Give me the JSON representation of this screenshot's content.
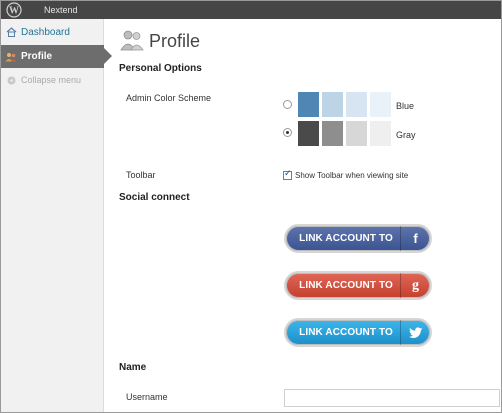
{
  "adminbar": {
    "site_name": "Nextend"
  },
  "sidebar": {
    "items": [
      {
        "label": "Dashboard",
        "icon": "home-icon"
      },
      {
        "label": "Profile",
        "icon": "users-icon",
        "active": true
      },
      {
        "label": "Collapse menu",
        "icon": "collapse-icon"
      }
    ]
  },
  "page": {
    "title": "Profile",
    "icon": "users-large-icon"
  },
  "personal_options": {
    "heading": "Personal Options",
    "color_scheme_label": "Admin Color Scheme",
    "schemes": [
      {
        "name": "Blue",
        "selected": false,
        "colors": [
          "#4f86b3",
          "#bcd4e6",
          "#d6e5f1",
          "#eaf2f9"
        ]
      },
      {
        "name": "Gray",
        "selected": true,
        "colors": [
          "#4a4a4a",
          "#8e8e8e",
          "#d7d7d7",
          "#efefef"
        ]
      }
    ],
    "toolbar_label": "Toolbar",
    "toolbar_checkbox_label": "Show Toolbar when viewing site",
    "toolbar_checked": true
  },
  "social_connect": {
    "heading": "Social connect",
    "buttons": [
      {
        "label": "LINK ACCOUNT TO",
        "icon": "facebook-icon",
        "glyph": "f"
      },
      {
        "label": "LINK ACCOUNT TO",
        "icon": "google-icon",
        "glyph": "g"
      },
      {
        "label": "LINK ACCOUNT TO",
        "icon": "twitter-icon",
        "glyph": ""
      }
    ]
  },
  "name_section": {
    "heading": "Name",
    "username_label": "Username",
    "username_value": ""
  }
}
